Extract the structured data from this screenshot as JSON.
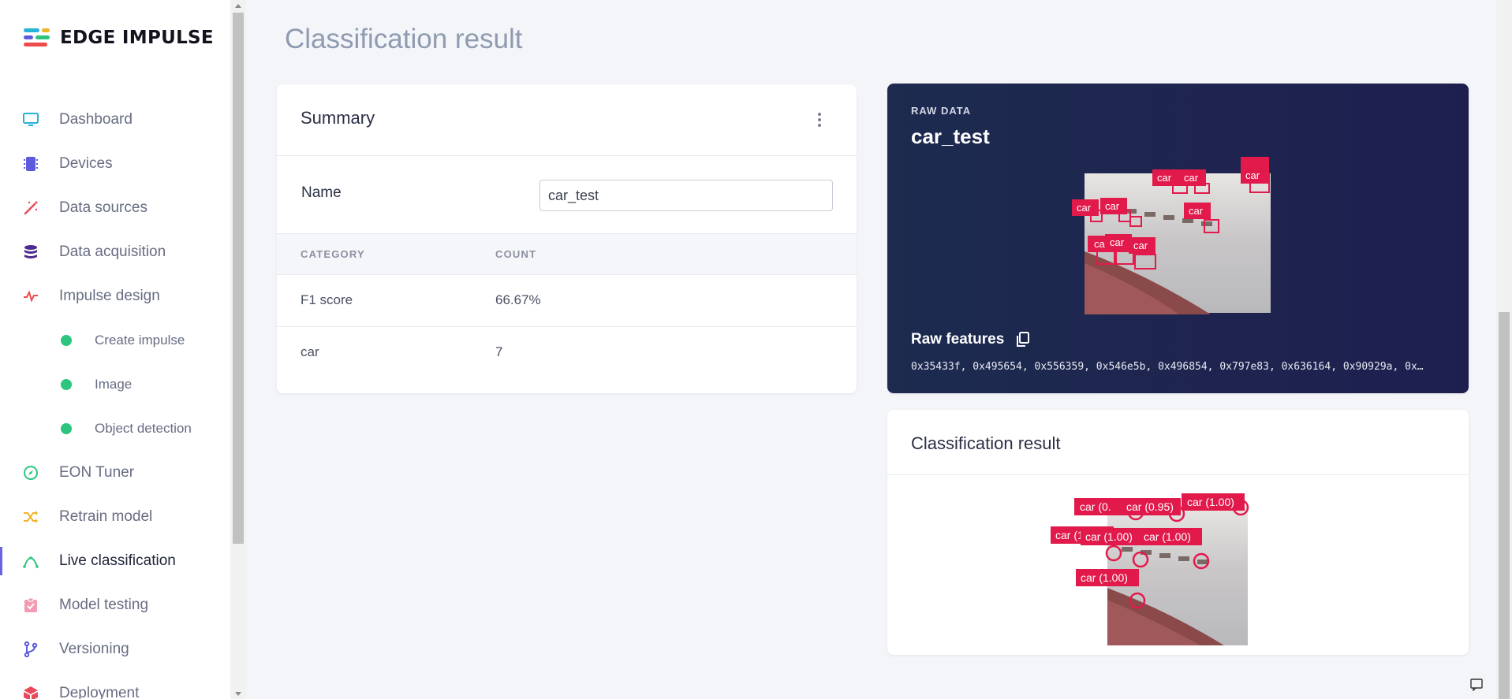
{
  "brand": {
    "name": "EDGE IMPULSE"
  },
  "sidebar": {
    "items": [
      {
        "label": "Dashboard",
        "icon": "monitor-icon",
        "color": "#27b3d8"
      },
      {
        "label": "Devices",
        "icon": "chip-icon",
        "color": "#5b5bdc"
      },
      {
        "label": "Data sources",
        "icon": "magic-wand-icon",
        "color": "#e94a5b"
      },
      {
        "label": "Data acquisition",
        "icon": "database-icon",
        "color": "#4d2a8f"
      },
      {
        "label": "Impulse design",
        "icon": "pulse-icon",
        "color": "#ef4b4b"
      },
      {
        "label": "Create impulse",
        "sub": true
      },
      {
        "label": "Image",
        "sub": true
      },
      {
        "label": "Object detection",
        "sub": true
      },
      {
        "label": "EON Tuner",
        "icon": "compass-icon",
        "color": "#2cc57e"
      },
      {
        "label": "Retrain model",
        "icon": "shuffle-icon",
        "color": "#f0b429"
      },
      {
        "label": "Live classification",
        "icon": "curve-icon",
        "color": "#2cc57e",
        "active": true
      },
      {
        "label": "Model testing",
        "icon": "clipboard-check-icon",
        "color": "#f29bb2"
      },
      {
        "label": "Versioning",
        "icon": "branch-icon",
        "color": "#5b5bdc"
      },
      {
        "label": "Deployment",
        "icon": "box-icon",
        "color": "#e94a5b"
      }
    ]
  },
  "page": {
    "title": "Classification result"
  },
  "summary": {
    "title": "Summary",
    "name_label": "Name",
    "name_value": "car_test",
    "columns": [
      "CATEGORY",
      "COUNT"
    ],
    "rows": [
      {
        "category": "F1 score",
        "count": "66.67%"
      },
      {
        "category": "car",
        "count": "7"
      }
    ]
  },
  "raw_data": {
    "kicker": "RAW DATA",
    "title": "car_test",
    "features_label": "Raw features",
    "features_value": "0x35433f, 0x495654, 0x556359, 0x546e5b, 0x496854, 0x797e83, 0x636164, 0x90929a, 0x…",
    "labels": [
      "car",
      "car",
      "car",
      "car",
      "car",
      "car",
      "ca",
      "car",
      "car"
    ]
  },
  "classification": {
    "title": "Classification result",
    "labels": [
      "car (0.",
      "car (0.95)",
      "car (1.00)",
      "car (1.00)",
      "car (1.00)",
      "car (1.00)",
      "car (1.00)"
    ]
  }
}
